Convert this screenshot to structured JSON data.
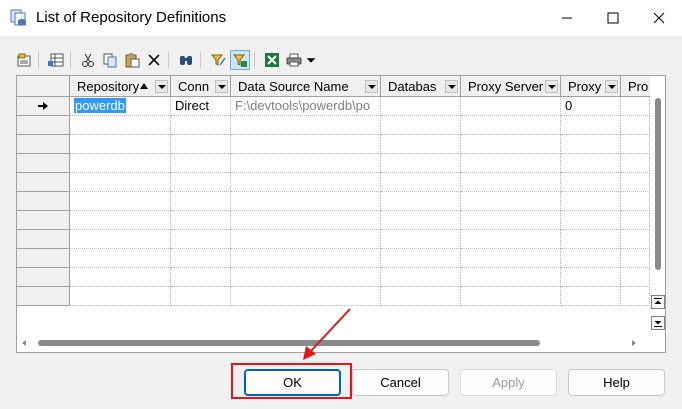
{
  "window": {
    "title": "List of Repository Definitions",
    "app_icon": "repository-icon",
    "controls": [
      "minimize-icon",
      "maximize-icon",
      "close-icon"
    ]
  },
  "toolbar": {
    "buttons": [
      "properties-icon",
      "add-row-icon",
      "cut-icon",
      "copy-icon",
      "paste-icon",
      "delete-icon",
      "find-icon",
      "filter-icon",
      "customize-columns-icon",
      "excel-export-icon",
      "print-icon",
      "dropdown-arrow-icon"
    ]
  },
  "grid": {
    "columns": [
      {
        "label": "Repository",
        "sorted": "ascending"
      },
      {
        "label": "Conn"
      },
      {
        "label": "Data Source Name"
      },
      {
        "label": "Databas"
      },
      {
        "label": "Proxy Server"
      },
      {
        "label": "Proxy"
      },
      {
        "label": "Pro"
      }
    ],
    "rows": [
      {
        "current": true,
        "cells": [
          "powerdb",
          "Direct",
          "F:\\devtools\\powerdb\\po",
          "",
          "",
          "0",
          ""
        ]
      }
    ],
    "empty_rows": 10
  },
  "buttons": {
    "ok": "OK",
    "cancel": "Cancel",
    "apply": "Apply",
    "help": "Help"
  },
  "annotation": {
    "color": "#e0161b"
  }
}
